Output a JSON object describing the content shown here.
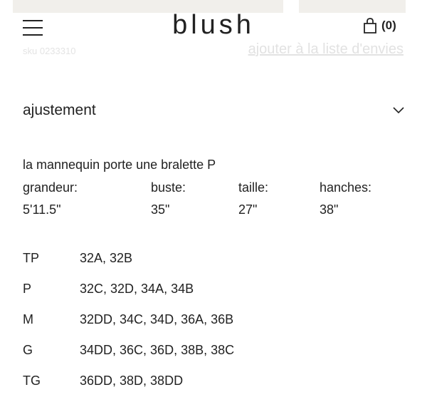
{
  "header": {
    "logo": "blush",
    "cart_count": "(0)"
  },
  "product": {
    "sku": "sku 0233310",
    "wishlist_label": "ajouter à la liste d'envies"
  },
  "fit_section": {
    "title": "ajustement",
    "model_line": "la mannequin porte une bralette P",
    "measurements": [
      {
        "label": "grandeur:",
        "value": "5'11.5\""
      },
      {
        "label": "buste:",
        "value": "35\""
      },
      {
        "label": "taille:",
        "value": "27\""
      },
      {
        "label": "hanches:",
        "value": "38\""
      }
    ],
    "sizes": [
      {
        "size": "TP",
        "fits": "32A, 32B"
      },
      {
        "size": "P",
        "fits": "32C, 32D, 34A, 34B"
      },
      {
        "size": "M",
        "fits": "32DD, 34C, 34D, 36A, 36B"
      },
      {
        "size": "G",
        "fits": "34DD, 36C, 36D, 38B, 38C"
      },
      {
        "size": "TG",
        "fits": "36DD, 38D, 38DD"
      }
    ]
  },
  "icons": {
    "menu": "hamburger-menu-icon",
    "cart": "shopping-bag-icon",
    "expand": "chevron-down-icon"
  }
}
